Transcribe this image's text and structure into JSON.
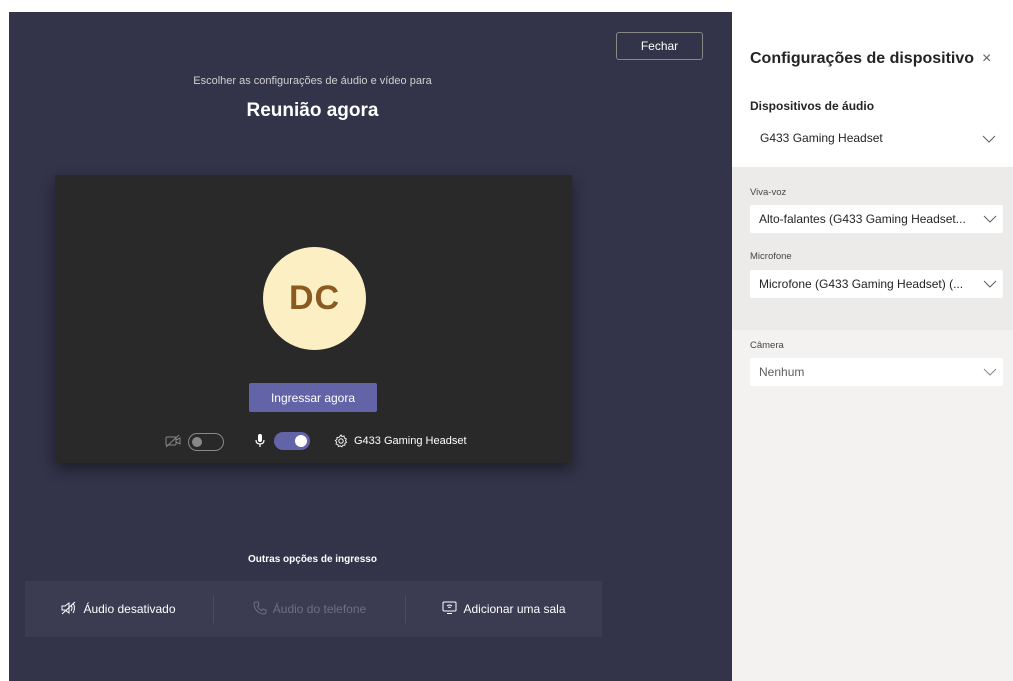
{
  "main": {
    "close_label": "Fechar",
    "subtitle": "Escolher as configurações de áudio e vídeo para",
    "title": "Reunião agora",
    "avatar_initials": "DC",
    "join_label": "Ingressar agora",
    "device_name": "G433 Gaming Headset",
    "other_options_title": "Outras opções de ingresso",
    "options": [
      {
        "label": "Áudio desativado",
        "icon": "speaker-off-icon"
      },
      {
        "label": "Áudio do telefone",
        "icon": "phone-icon"
      },
      {
        "label": "Adicionar uma sala",
        "icon": "cast-icon"
      }
    ],
    "toggles": {
      "camera_on": false,
      "mic_on": true
    }
  },
  "panel": {
    "title": "Configurações de dispositivo",
    "audio_devices_label": "Dispositivos de áudio",
    "audio_device_value": "G433 Gaming Headset",
    "speaker_label": "Viva-voz",
    "speaker_value": "Alto-falantes (G433 Gaming Headset...",
    "mic_label": "Microfone",
    "mic_value": "Microfone (G433 Gaming Headset) (...",
    "camera_label": "Câmera",
    "camera_value": "Nenhum"
  },
  "colors": {
    "background": "#33344a",
    "accent": "#6264a7",
    "avatar_bg": "#fcefc3",
    "panel_bg": "#f3f2f1"
  }
}
